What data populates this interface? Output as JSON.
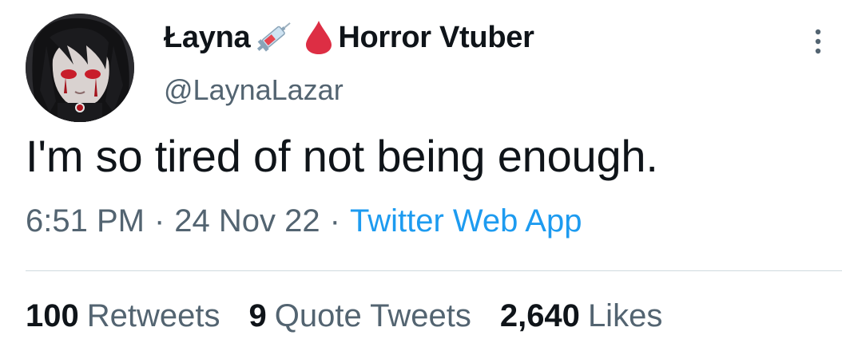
{
  "author": {
    "display_name": "Łayna",
    "emojis": [
      "syringe-emoji",
      "drop-of-blood-emoji"
    ],
    "display_name_suffix": "Horror Vtuber",
    "handle": "@LaynaLazar"
  },
  "tweet": {
    "text": "I'm so tired of not being enough.",
    "time": "6:51 PM",
    "separator": "·",
    "date": "24 Nov 22",
    "source": "Twitter Web App"
  },
  "stats": {
    "retweets_count": "100",
    "retweets_label": "Retweets",
    "quote_count": "9",
    "quote_label": "Quote Tweets",
    "likes_count": "2,640",
    "likes_label": "Likes"
  },
  "colors": {
    "text_primary": "#0f1419",
    "text_secondary": "#536471",
    "link": "#1d9bf0",
    "divider": "#cfd9de"
  }
}
